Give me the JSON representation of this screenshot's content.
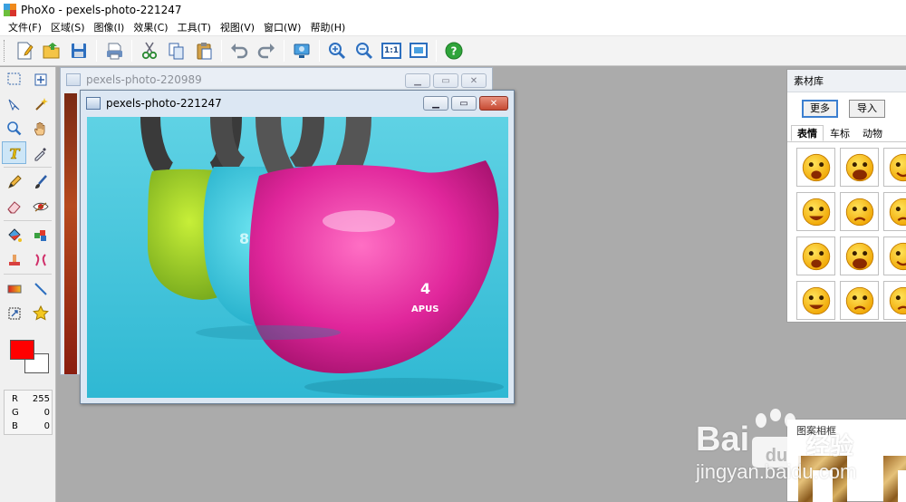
{
  "app": {
    "title": "PhoXo - pexels-photo-221247"
  },
  "menu": [
    "文件(F)",
    "区域(S)",
    "图像(I)",
    "效果(C)",
    "工具(T)",
    "视图(V)",
    "窗口(W)",
    "帮助(H)"
  ],
  "toolbar": {
    "buttons": [
      "new-icon",
      "open-icon",
      "save-icon",
      "print-icon",
      "cut-icon",
      "copy-icon",
      "paste-icon",
      "undo-icon",
      "redo-icon",
      "screen-icon",
      "zoom-in-icon",
      "zoom-out-icon",
      "actual-size-icon",
      "fit-window-icon",
      "help-icon"
    ],
    "actual_size_label": "1:1"
  },
  "tools": {
    "rows": [
      [
        "rect-select-icon",
        "move-icon"
      ],
      [
        "lasso-icon",
        "magic-wand-icon"
      ],
      [
        "zoom-icon",
        "hand-icon"
      ],
      [
        "text-icon",
        "eyedropper-icon"
      ],
      [
        "pencil-icon",
        "brush-icon"
      ],
      [
        "eraser-icon",
        "red-eye-icon"
      ],
      [
        "fill-icon",
        "color-replace-icon"
      ],
      [
        "clone-stamp-icon",
        "heal-icon"
      ],
      [
        "gradient-icon",
        "line-icon"
      ],
      [
        "transform-icon",
        "star-shape-icon"
      ]
    ],
    "active": "text-icon"
  },
  "colors": {
    "foreground": "#ff0000",
    "background": "#ffffff"
  },
  "rgb": [
    {
      "label": "R",
      "value": "255"
    },
    {
      "label": "G",
      "value": "0"
    },
    {
      "label": "B",
      "value": "0"
    }
  ],
  "back_window": {
    "title": "pexels-photo-220989"
  },
  "front_window": {
    "title": "pexels-photo-221247"
  },
  "library": {
    "title": "素材库",
    "more_label": "更多",
    "import_label": "导入",
    "tabs": [
      "表情",
      "车标",
      "动物"
    ],
    "active_tab": "表情",
    "emojis": [
      "dizzy-face-icon",
      "shouting-face-icon",
      "grinning-face-icon",
      "rolling-laugh-icon",
      "pleading-face-icon",
      "crying-face-icon",
      "winking-face-icon",
      "angry-face-icon",
      "furious-face-icon",
      "sobbing-face-icon",
      "frowning-face-icon",
      "burning-face-icon"
    ]
  },
  "frame_panel": {
    "title": "图案相框"
  },
  "watermark": {
    "brand": "Bai",
    "brand_suffix": "经验",
    "url": "jingyan.baidu.com"
  }
}
